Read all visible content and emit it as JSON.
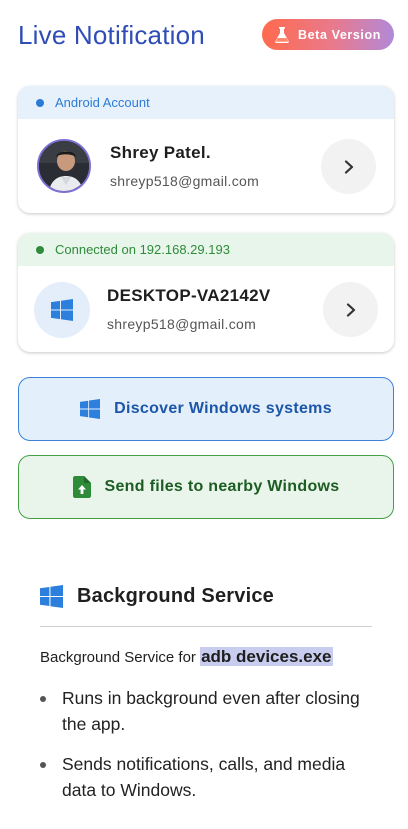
{
  "header": {
    "title": "Live Notification",
    "beta_label": "Beta Version"
  },
  "android_card": {
    "status": "Android Account",
    "name": "Shrey Patel.",
    "email": "shreyp518@gmail.com"
  },
  "desktop_card": {
    "status": "Connected on 192.168.29.193",
    "name": "DESKTOP-VA2142V",
    "email": "shreyp518@gmail.com"
  },
  "actions": {
    "discover_label": "Discover Windows systems",
    "send_label": "Send files to nearby Windows"
  },
  "background_service": {
    "title": "Background Service",
    "desc_prefix": "Background Service for ",
    "desc_highlight": "adb devices.exe",
    "bullets": [
      "Runs in background even after closing the app.",
      "Sends notifications, calls, and media data to Windows."
    ]
  },
  "colors": {
    "title": "#2f4db5",
    "android_status": "#2b7bd6",
    "connected_status": "#2e8b3a",
    "discover_button": "#e4effc",
    "send_button": "#e9f5ea"
  }
}
